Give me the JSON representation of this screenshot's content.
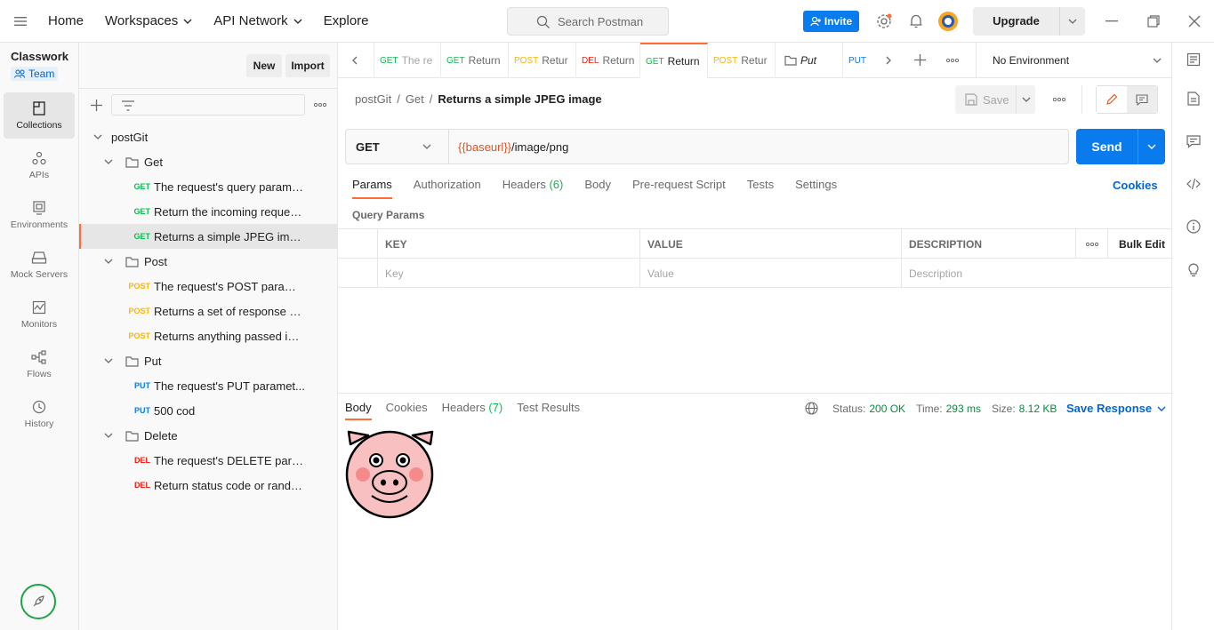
{
  "topbar": {
    "nav": [
      "Home",
      "Workspaces",
      "API Network",
      "Explore"
    ],
    "search_placeholder": "Search Postman",
    "invite_label": "Invite",
    "upgrade_label": "Upgrade"
  },
  "workspace": {
    "name": "Classwork",
    "team_label": "Team",
    "new_label": "New",
    "import_label": "Import"
  },
  "rail": [
    {
      "label": "Collections",
      "icon": "collections-icon",
      "active": true
    },
    {
      "label": "APIs",
      "icon": "apis-icon"
    },
    {
      "label": "Environments",
      "icon": "environments-icon"
    },
    {
      "label": "Mock Servers",
      "icon": "mock-servers-icon"
    },
    {
      "label": "Monitors",
      "icon": "monitors-icon"
    },
    {
      "label": "Flows",
      "icon": "flows-icon"
    },
    {
      "label": "History",
      "icon": "history-icon"
    }
  ],
  "tree": {
    "collection": "postGit",
    "folders": [
      {
        "name": "Get",
        "requests": [
          {
            "method": "GET",
            "label": "The request's query parame..."
          },
          {
            "method": "GET",
            "label": "Return the incoming reques..."
          },
          {
            "method": "GET",
            "label": "Returns a simple JPEG image",
            "selected": true
          }
        ]
      },
      {
        "name": "Post",
        "requests": [
          {
            "method": "POST",
            "label": "The request's POST parame..."
          },
          {
            "method": "POST",
            "label": "Returns a set of response h..."
          },
          {
            "method": "POST",
            "label": "Returns anything passed in ..."
          }
        ]
      },
      {
        "name": "Put",
        "requests": [
          {
            "method": "PUT",
            "label": "The request's PUT paramet..."
          },
          {
            "method": "PUT",
            "label": "500 cod"
          }
        ]
      },
      {
        "name": "Delete",
        "requests": [
          {
            "method": "DEL",
            "label": "The request's DELETE para..."
          },
          {
            "method": "DEL",
            "label": "Return status code or rando..."
          }
        ]
      }
    ]
  },
  "tabs": [
    {
      "method": "GET",
      "label": "The re"
    },
    {
      "method": "GET",
      "label": "Return"
    },
    {
      "method": "POST",
      "label": "Retur"
    },
    {
      "method": "DEL",
      "label": "Return"
    },
    {
      "method": "GET",
      "label": "Return",
      "active": true
    },
    {
      "method": "POST",
      "label": "Retur"
    },
    {
      "method": "",
      "label": "Put",
      "folder": true
    },
    {
      "method": "PUT",
      "label": ""
    }
  ],
  "environment": "No Environment",
  "breadcrumb": {
    "collection": "postGit",
    "folder": "Get",
    "request": "Returns a simple JPEG image"
  },
  "save_label": "Save",
  "request": {
    "method": "GET",
    "url_var": "{{baseurl}}",
    "url_path": "/image/png",
    "send_label": "Send"
  },
  "request_tabs": [
    {
      "label": "Params",
      "active": true
    },
    {
      "label": "Authorization"
    },
    {
      "label": "Headers",
      "count": "(6)"
    },
    {
      "label": "Body"
    },
    {
      "label": "Pre-request Script"
    },
    {
      "label": "Tests"
    },
    {
      "label": "Settings"
    }
  ],
  "cookies_label": "Cookies",
  "query_params": {
    "title": "Query Params",
    "headers": [
      "KEY",
      "VALUE",
      "DESCRIPTION"
    ],
    "bulk_edit": "Bulk Edit",
    "placeholders": [
      "Key",
      "Value",
      "Description"
    ]
  },
  "response": {
    "tabs": [
      {
        "label": "Body",
        "active": true
      },
      {
        "label": "Cookies"
      },
      {
        "label": "Headers",
        "count": "(7)"
      },
      {
        "label": "Test Results"
      }
    ],
    "status_label": "Status:",
    "status": "200 OK",
    "time_label": "Time:",
    "time": "293 ms",
    "size_label": "Size:",
    "size": "8.12 KB",
    "save_response": "Save Response"
  },
  "colors": {
    "accent": "#ff6c37",
    "primary": "#097bed",
    "get": "#0cbb52",
    "post": "#ffb400",
    "put": "#097bed",
    "delete": "#eb2013"
  }
}
